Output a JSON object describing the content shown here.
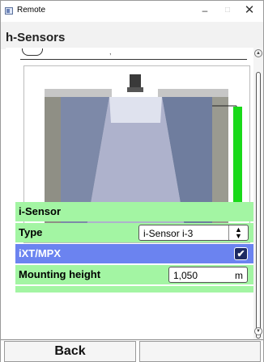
{
  "window": {
    "title": "Remote",
    "minimize_glyph": "–",
    "maximize_glyph": "□",
    "close_glyph": "✕"
  },
  "header": {
    "title": "h-Sensors"
  },
  "illustration": {
    "description_icon": "tank-sensor-illustration",
    "level_bar_color": "#19d919",
    "level_fraction": 0.8
  },
  "sensor_section": {
    "title": "i-Sensor"
  },
  "fields": {
    "type": {
      "label": "Type",
      "value": "i-Sensor i-3"
    },
    "ixt": {
      "label": "iXT/MPX",
      "checked": true,
      "check_glyph": "✔"
    },
    "mounting_height": {
      "label": "Mounting height",
      "value": "1,050",
      "unit": "m"
    }
  },
  "footer": {
    "back_label": "Back",
    "second_label": ""
  },
  "colors": {
    "section_bg": "#a3f5a3",
    "selected_row_bg": "#6b83f0",
    "checkbox_bg": "#1d2a63"
  }
}
